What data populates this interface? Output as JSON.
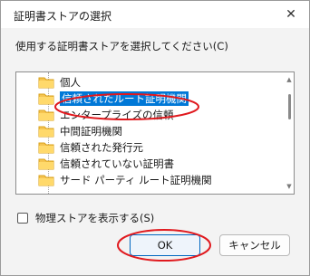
{
  "dialog": {
    "title": "証明書ストアの選択",
    "prompt": "使用する証明書ストアを選択してください(C)"
  },
  "tree": {
    "items": [
      {
        "label": "個人",
        "icon": "folder-icon",
        "selected": false
      },
      {
        "label": "信頼されたルート証明機関",
        "icon": "folder-icon",
        "selected": true
      },
      {
        "label": "エンタープライズの信頼",
        "icon": "folder-icon",
        "selected": false
      },
      {
        "label": "中間証明機関",
        "icon": "folder-icon",
        "selected": false
      },
      {
        "label": "信頼された発行元",
        "icon": "folder-icon",
        "selected": false
      },
      {
        "label": "信頼されていない証明書",
        "icon": "folder-icon",
        "selected": false
      },
      {
        "label": "サード パーティ ルート証明機関",
        "icon": "folder-icon",
        "selected": false
      }
    ]
  },
  "options": {
    "show_physical_label": "物理ストアを表示する(S)",
    "show_physical_checked": false
  },
  "buttons": {
    "ok_label": "OK",
    "cancel_label": "キャンセル"
  },
  "annotation_color": "#e0191e"
}
